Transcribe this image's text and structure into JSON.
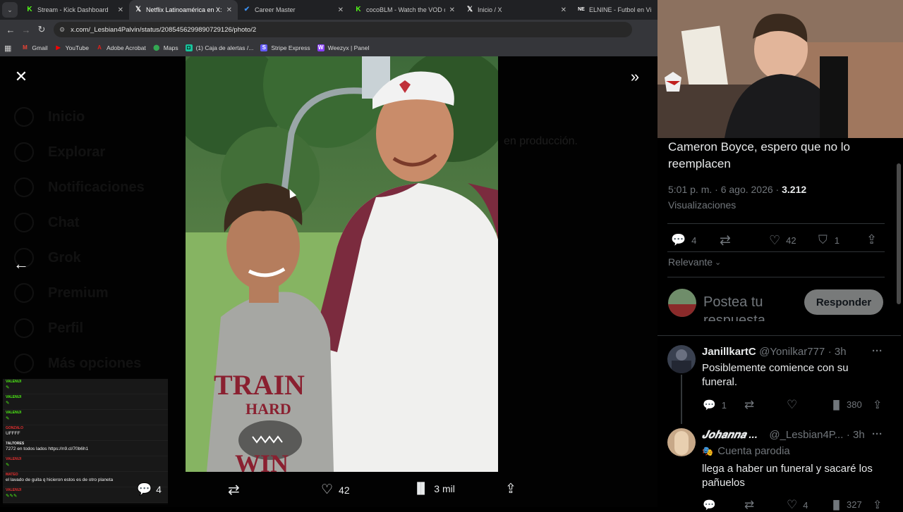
{
  "browser": {
    "tabs_menu_icon": "chevron-down-icon",
    "tabs": [
      {
        "title": "Stream - Kick Dashboard",
        "icon": "kick-icon",
        "color": "#53fc18",
        "active": false
      },
      {
        "title": "Netflix Latinoamérica en X: \"¡To",
        "icon": "x-logo-icon",
        "color": "#ffffff",
        "active": true
      },
      {
        "title": "Career Master",
        "icon": "career-icon",
        "color": "#3a8eed",
        "active": false
      },
      {
        "title": "cocoBLM - Watch the VOD on K",
        "icon": "kick-icon",
        "color": "#53fc18",
        "active": false
      },
      {
        "title": "Inicio / X",
        "icon": "x-logo-icon",
        "color": "#ffffff",
        "active": false
      },
      {
        "title": "ELNINE - Futbol en Vivo",
        "icon": "elnine-icon",
        "color": "#ffffff",
        "active": false
      }
    ],
    "url": "x.com/_Lesbian4Palvin/status/2085456299890729126/photo/2",
    "bookmarks": [
      {
        "label": "Gmail",
        "icon": "gmail-icon",
        "color": "#ea4335"
      },
      {
        "label": "YouTube",
        "icon": "youtube-icon",
        "color": "#ff0000"
      },
      {
        "label": "Adobe Acrobat",
        "icon": "acrobat-icon",
        "color": "#e0201a"
      },
      {
        "label": "Maps",
        "icon": "maps-icon",
        "color": "#34a853"
      },
      {
        "label": "(1) Caja de alertas /...",
        "icon": "alerts-icon",
        "color": "#19c39c"
      },
      {
        "label": "Stripe Express",
        "icon": "stripe-icon",
        "color": "#635bff"
      },
      {
        "label": "Weezyx | Panel",
        "icon": "weezyx-icon",
        "color": "#8a3ffc"
      }
    ]
  },
  "background_nav": {
    "items": [
      "Inicio",
      "Explorar",
      "Notificaciones",
      "Chat",
      "Grok",
      "Premium",
      "Perfil",
      "Más opciones"
    ],
    "faded_text": "en producción."
  },
  "media_viewer": {
    "close_icon": "close-icon",
    "expand_icon": "double-chevron-right-icon",
    "prev_icon": "arrow-left-icon",
    "actions": {
      "replies": "4",
      "retweets": "",
      "likes": "42",
      "views": "3 mil"
    }
  },
  "stream_chat": {
    "messages": [
      {
        "user": "VALENIJI",
        "text": "",
        "user_color": "#53fc18"
      },
      {
        "user": "VALENIJI",
        "text": "",
        "user_color": "#53fc18"
      },
      {
        "user": "VALENIJI",
        "text": "",
        "user_color": "#53fc18"
      },
      {
        "user": "GONZALO",
        "text": "UFFFF",
        "user_color": "#e33"
      },
      {
        "user": "7ALTORES",
        "text": "7272 en todos lados https://n9.cl/70b6h1",
        "user_color": "#fff"
      },
      {
        "user": "VALENIJI",
        "text": "",
        "user_color": "#e33"
      },
      {
        "user": "MATEO",
        "text": "el lavado de guita q hicieron estos es de otro planeta",
        "user_color": "#e33"
      },
      {
        "user": "VALENIJI",
        "text": "",
        "user_color": "#e33"
      }
    ]
  },
  "tweet": {
    "text": "Cameron Boyce, espero que no lo reemplacen",
    "time": "5:01 p. m. · 6 ago. 2026 ·",
    "views_count": "3.212",
    "views_label": "Visualizaciones",
    "stats": {
      "replies": "4",
      "retweets": "",
      "likes": "42",
      "bookmarks": "1"
    },
    "sort_label": "Relevante",
    "compose_placeholder": "Postea tu respuesta",
    "reply_button": "Responder"
  },
  "replies": [
    {
      "name": "JanillkartC",
      "handle": "@Yonilkar777",
      "time": "· 3h",
      "text": "Posiblemente comience con su funeral.",
      "stats": {
        "replies": "1",
        "retweets": "",
        "likes": "",
        "views": "380"
      }
    },
    {
      "name": "𝑱𝒐𝒉𝒂𝒏𝒏𝒂 ...",
      "handle": "@_Lesbian4P...",
      "time": "· 3h",
      "badge": "Cuenta parodia",
      "text": "llega  a haber un funeral y sacaré los pañuelos",
      "stats": {
        "replies": "",
        "retweets": "",
        "likes": "4",
        "views": "327"
      }
    }
  ]
}
